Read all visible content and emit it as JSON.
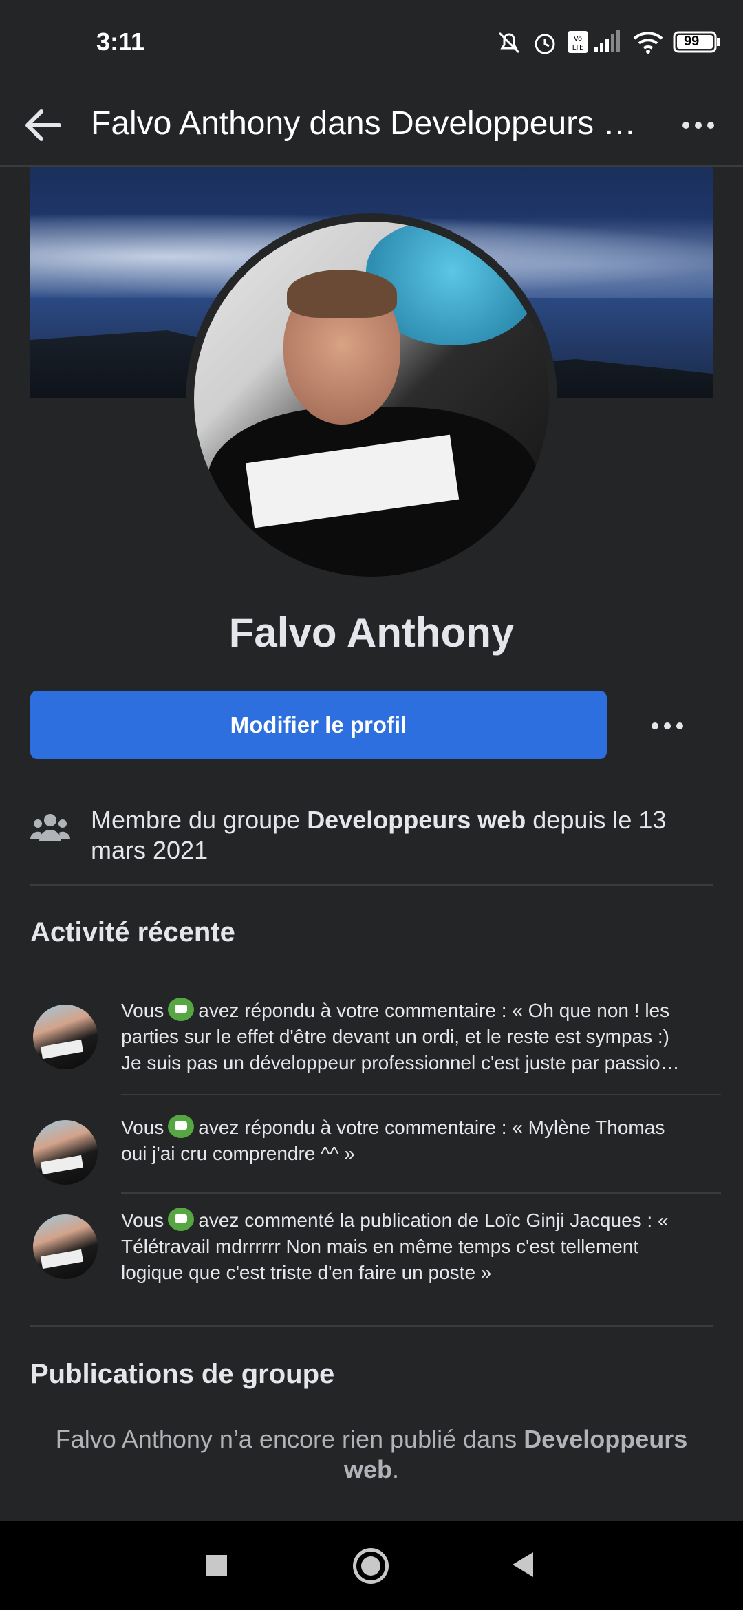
{
  "status_bar": {
    "time": "3:11",
    "battery": "99"
  },
  "app_bar": {
    "title": "Falvo Anthony dans Developpeurs web"
  },
  "profile": {
    "name": "Falvo Anthony",
    "edit_button": "Modifier le profil"
  },
  "membership": {
    "prefix": "Membre du groupe ",
    "group": "Developpeurs web",
    "suffix": " depuis le 13 mars 2021"
  },
  "recent_activity": {
    "title": "Activité récente",
    "items": [
      {
        "you": "Vous",
        "text": "avez répondu à votre commentaire : « Oh que non ! les parties sur le effet d'être devant un ordi, et le reste est sympas :) Je suis pas un développeur professionnel c'est juste par passio…"
      },
      {
        "you": "Vous",
        "text": "avez répondu à votre commentaire : « Mylène Thomas oui j'ai cru comprendre ^^ »"
      },
      {
        "you": "Vous",
        "text": "avez commenté la publication de Loïc Ginji Jacques : « Télétravail mdrrrrrr Non mais en même temps c'est tellement logique que c'est triste d'en faire un poste »"
      }
    ]
  },
  "group_posts": {
    "title": "Publications de groupe",
    "empty_prefix": "Falvo Anthony n’a encore rien publié dans ",
    "empty_group": "Developpeurs web",
    "empty_suffix": "."
  },
  "colors": {
    "background": "#242526",
    "primary_button": "#2d6fdf",
    "badge_green": "#56a643"
  }
}
